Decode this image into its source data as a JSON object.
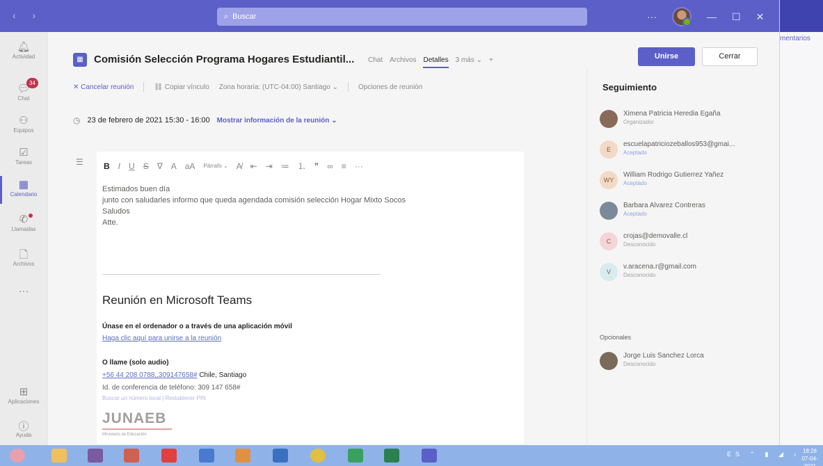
{
  "titlebar": {
    "search_placeholder": "Buscar",
    "window_controls": [
      "···",
      "—",
      "☐",
      "✕"
    ]
  },
  "background_window": {
    "tab_label": "mentarios"
  },
  "rail": {
    "items": [
      {
        "label": "Actividad",
        "icon": "bell-icon"
      },
      {
        "label": "Chat",
        "icon": "chat-icon",
        "badge": "34"
      },
      {
        "label": "Equipos",
        "icon": "teams-icon"
      },
      {
        "label": "Tareas",
        "icon": "tasks-icon"
      },
      {
        "label": "Calendario",
        "icon": "calendar-icon"
      },
      {
        "label": "Llamadas",
        "icon": "phone-icon"
      },
      {
        "label": "Archivos",
        "icon": "file-icon"
      },
      {
        "label": "···",
        "icon": "more-icon"
      },
      {
        "label": "Aplicaciones",
        "icon": "apps-icon"
      },
      {
        "label": "Ayuda",
        "icon": "help-icon"
      }
    ]
  },
  "header": {
    "title": "Comisión Selección Programa Hogares Estudiantil...",
    "tabs": [
      "Chat",
      "Archivos",
      "Detalles",
      "3 más"
    ],
    "join_label": "Unirse",
    "close_label": "Cerrar"
  },
  "toolbar": {
    "cancel": "Cancelar reunión",
    "copy_link": "Copiar vínculo",
    "timezone": "Zona horaria: (UTC-04:00) Santiago",
    "options": "Opciones de reunión"
  },
  "meeting": {
    "datetime": "23 de febrero de 2021 15:30 - 16:00",
    "show_info": "Mostrar información de la reunión"
  },
  "editor": {
    "paragraph_label": "Párrafo",
    "body_lines": [
      "Estimados buen día",
      "junto con saludarles informo que queda agendada comisión selección Hogar Mixto Socos",
      "Saludos",
      "Atte."
    ],
    "teams_heading": "Reunión en Microsoft Teams",
    "join_text": "Únase en el ordenador o a través de una aplicación móvil",
    "join_link": "Haga clic aquí para unirse a la reunión",
    "call_text": "O llame (solo audio)",
    "phone_link": "+56 44 208 0788,,309147658#",
    "phone_city": "Chile, Santiago",
    "conf_id": "Id. de conferencia de teléfono: 309 147 658#",
    "local_links": "Buscar un número local | Restablecer PIN",
    "logo": "JUNAEB",
    "logo_tag": "Ministerio de Educación"
  },
  "tracking": {
    "title": "Seguimiento",
    "people": [
      {
        "name": "Ximena Patricia Heredia Egaña",
        "status": "Organizador",
        "initials": "",
        "color": "#8a6a5a"
      },
      {
        "name": "escuelapatriciozeballos953@gmai...",
        "status": "Aceptado",
        "initials": "E",
        "color": "#f3d9c6"
      },
      {
        "name": "William Rodrigo Gutierrez Yañez",
        "status": "Aceptado",
        "initials": "WY",
        "color": "#f3d9c6"
      },
      {
        "name": "Barbara Alvarez Contreras",
        "status": "Aceptado",
        "initials": "",
        "color": "#7a8a9a"
      },
      {
        "name": "crojas@demovalle.cl",
        "status": "Desconocido",
        "initials": "C",
        "color": "#f5d4d8"
      },
      {
        "name": "v.aracena.r@gmail.com",
        "status": "Desconocido",
        "initials": "V",
        "color": "#d6ecef"
      }
    ],
    "optional_label": "Opcionales",
    "optional_people": [
      {
        "name": "Jorge Luis Sanchez Lorca",
        "status": "Desconocido",
        "initials": "",
        "color": "#7a6a5a"
      }
    ]
  },
  "taskbar": {
    "time": "18:26",
    "date": "07-04-2021"
  }
}
